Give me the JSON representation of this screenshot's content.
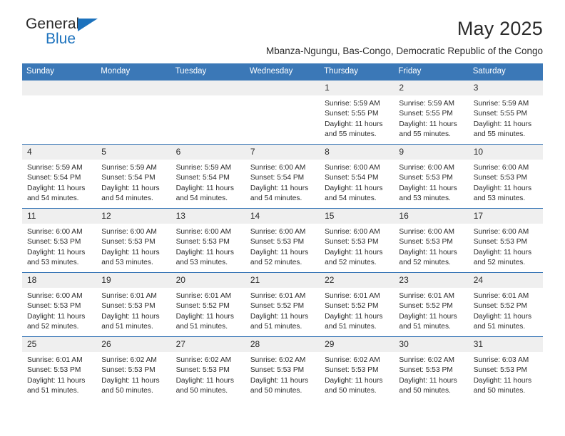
{
  "brand": {
    "name_top": "General",
    "name_bottom": "Blue",
    "accent_color": "#1c72bd"
  },
  "header": {
    "title": "May 2025",
    "subtitle": "Mbanza-Ngungu, Bas-Congo, Democratic Republic of the Congo"
  },
  "calendar": {
    "header_color": "#3b78b7",
    "daynum_background": "#efefef",
    "weekday_headers": [
      "Sunday",
      "Monday",
      "Tuesday",
      "Wednesday",
      "Thursday",
      "Friday",
      "Saturday"
    ],
    "weeks": [
      [
        {
          "day": "",
          "lines": []
        },
        {
          "day": "",
          "lines": []
        },
        {
          "day": "",
          "lines": []
        },
        {
          "day": "",
          "lines": []
        },
        {
          "day": "1",
          "lines": [
            "Sunrise: 5:59 AM",
            "Sunset: 5:55 PM",
            "Daylight: 11 hours",
            "and 55 minutes."
          ]
        },
        {
          "day": "2",
          "lines": [
            "Sunrise: 5:59 AM",
            "Sunset: 5:55 PM",
            "Daylight: 11 hours",
            "and 55 minutes."
          ]
        },
        {
          "day": "3",
          "lines": [
            "Sunrise: 5:59 AM",
            "Sunset: 5:55 PM",
            "Daylight: 11 hours",
            "and 55 minutes."
          ]
        }
      ],
      [
        {
          "day": "4",
          "lines": [
            "Sunrise: 5:59 AM",
            "Sunset: 5:54 PM",
            "Daylight: 11 hours",
            "and 54 minutes."
          ]
        },
        {
          "day": "5",
          "lines": [
            "Sunrise: 5:59 AM",
            "Sunset: 5:54 PM",
            "Daylight: 11 hours",
            "and 54 minutes."
          ]
        },
        {
          "day": "6",
          "lines": [
            "Sunrise: 5:59 AM",
            "Sunset: 5:54 PM",
            "Daylight: 11 hours",
            "and 54 minutes."
          ]
        },
        {
          "day": "7",
          "lines": [
            "Sunrise: 6:00 AM",
            "Sunset: 5:54 PM",
            "Daylight: 11 hours",
            "and 54 minutes."
          ]
        },
        {
          "day": "8",
          "lines": [
            "Sunrise: 6:00 AM",
            "Sunset: 5:54 PM",
            "Daylight: 11 hours",
            "and 54 minutes."
          ]
        },
        {
          "day": "9",
          "lines": [
            "Sunrise: 6:00 AM",
            "Sunset: 5:53 PM",
            "Daylight: 11 hours",
            "and 53 minutes."
          ]
        },
        {
          "day": "10",
          "lines": [
            "Sunrise: 6:00 AM",
            "Sunset: 5:53 PM",
            "Daylight: 11 hours",
            "and 53 minutes."
          ]
        }
      ],
      [
        {
          "day": "11",
          "lines": [
            "Sunrise: 6:00 AM",
            "Sunset: 5:53 PM",
            "Daylight: 11 hours",
            "and 53 minutes."
          ]
        },
        {
          "day": "12",
          "lines": [
            "Sunrise: 6:00 AM",
            "Sunset: 5:53 PM",
            "Daylight: 11 hours",
            "and 53 minutes."
          ]
        },
        {
          "day": "13",
          "lines": [
            "Sunrise: 6:00 AM",
            "Sunset: 5:53 PM",
            "Daylight: 11 hours",
            "and 53 minutes."
          ]
        },
        {
          "day": "14",
          "lines": [
            "Sunrise: 6:00 AM",
            "Sunset: 5:53 PM",
            "Daylight: 11 hours",
            "and 52 minutes."
          ]
        },
        {
          "day": "15",
          "lines": [
            "Sunrise: 6:00 AM",
            "Sunset: 5:53 PM",
            "Daylight: 11 hours",
            "and 52 minutes."
          ]
        },
        {
          "day": "16",
          "lines": [
            "Sunrise: 6:00 AM",
            "Sunset: 5:53 PM",
            "Daylight: 11 hours",
            "and 52 minutes."
          ]
        },
        {
          "day": "17",
          "lines": [
            "Sunrise: 6:00 AM",
            "Sunset: 5:53 PM",
            "Daylight: 11 hours",
            "and 52 minutes."
          ]
        }
      ],
      [
        {
          "day": "18",
          "lines": [
            "Sunrise: 6:00 AM",
            "Sunset: 5:53 PM",
            "Daylight: 11 hours",
            "and 52 minutes."
          ]
        },
        {
          "day": "19",
          "lines": [
            "Sunrise: 6:01 AM",
            "Sunset: 5:53 PM",
            "Daylight: 11 hours",
            "and 51 minutes."
          ]
        },
        {
          "day": "20",
          "lines": [
            "Sunrise: 6:01 AM",
            "Sunset: 5:52 PM",
            "Daylight: 11 hours",
            "and 51 minutes."
          ]
        },
        {
          "day": "21",
          "lines": [
            "Sunrise: 6:01 AM",
            "Sunset: 5:52 PM",
            "Daylight: 11 hours",
            "and 51 minutes."
          ]
        },
        {
          "day": "22",
          "lines": [
            "Sunrise: 6:01 AM",
            "Sunset: 5:52 PM",
            "Daylight: 11 hours",
            "and 51 minutes."
          ]
        },
        {
          "day": "23",
          "lines": [
            "Sunrise: 6:01 AM",
            "Sunset: 5:52 PM",
            "Daylight: 11 hours",
            "and 51 minutes."
          ]
        },
        {
          "day": "24",
          "lines": [
            "Sunrise: 6:01 AM",
            "Sunset: 5:52 PM",
            "Daylight: 11 hours",
            "and 51 minutes."
          ]
        }
      ],
      [
        {
          "day": "25",
          "lines": [
            "Sunrise: 6:01 AM",
            "Sunset: 5:53 PM",
            "Daylight: 11 hours",
            "and 51 minutes."
          ]
        },
        {
          "day": "26",
          "lines": [
            "Sunrise: 6:02 AM",
            "Sunset: 5:53 PM",
            "Daylight: 11 hours",
            "and 50 minutes."
          ]
        },
        {
          "day": "27",
          "lines": [
            "Sunrise: 6:02 AM",
            "Sunset: 5:53 PM",
            "Daylight: 11 hours",
            "and 50 minutes."
          ]
        },
        {
          "day": "28",
          "lines": [
            "Sunrise: 6:02 AM",
            "Sunset: 5:53 PM",
            "Daylight: 11 hours",
            "and 50 minutes."
          ]
        },
        {
          "day": "29",
          "lines": [
            "Sunrise: 6:02 AM",
            "Sunset: 5:53 PM",
            "Daylight: 11 hours",
            "and 50 minutes."
          ]
        },
        {
          "day": "30",
          "lines": [
            "Sunrise: 6:02 AM",
            "Sunset: 5:53 PM",
            "Daylight: 11 hours",
            "and 50 minutes."
          ]
        },
        {
          "day": "31",
          "lines": [
            "Sunrise: 6:03 AM",
            "Sunset: 5:53 PM",
            "Daylight: 11 hours",
            "and 50 minutes."
          ]
        }
      ]
    ]
  }
}
